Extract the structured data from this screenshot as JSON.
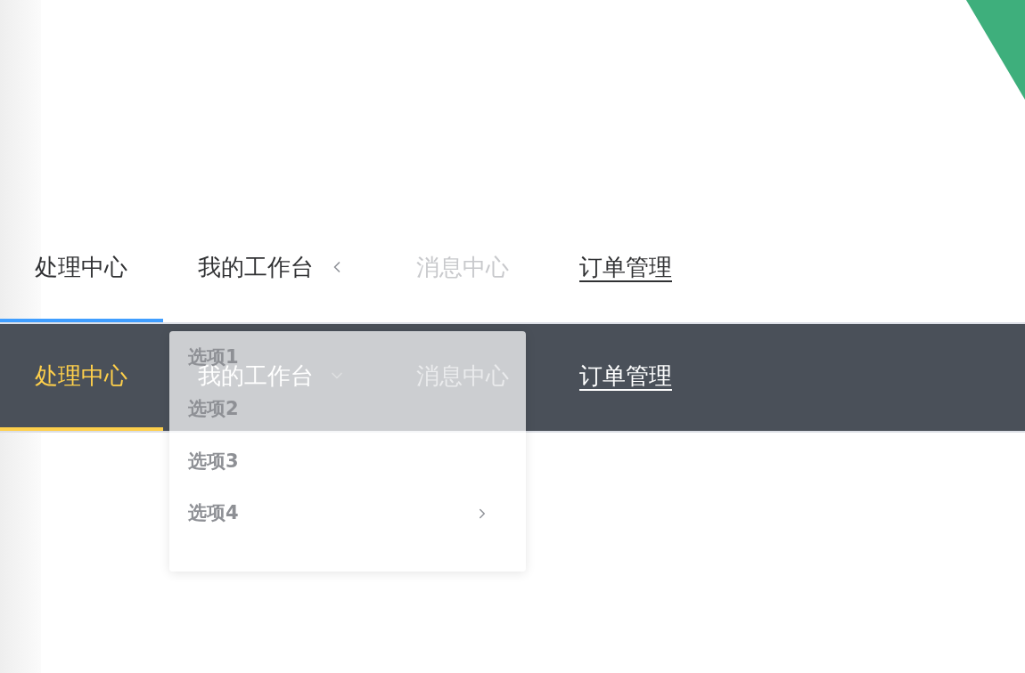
{
  "menus": [
    {
      "kind": "light",
      "items": [
        {
          "label": "处理中心",
          "kind": "item",
          "selected": true,
          "disabled": false
        },
        {
          "label": "我的工作台",
          "kind": "submenu",
          "selected": false,
          "disabled": false,
          "expanded": true
        },
        {
          "label": "消息中心",
          "kind": "item",
          "selected": false,
          "disabled": true
        },
        {
          "label": "订单管理",
          "kind": "link",
          "selected": false,
          "disabled": false
        }
      ]
    },
    {
      "kind": "dark",
      "items": [
        {
          "label": "处理中心",
          "kind": "item",
          "selected": true,
          "disabled": false
        },
        {
          "label": "我的工作台",
          "kind": "submenu",
          "selected": false,
          "disabled": false,
          "expanded": false
        },
        {
          "label": "消息中心",
          "kind": "item",
          "selected": false,
          "disabled": true
        },
        {
          "label": "订单管理",
          "kind": "link",
          "selected": false,
          "disabled": false
        }
      ]
    }
  ],
  "dropdown": {
    "items": [
      {
        "label": "选项1",
        "kind": "item"
      },
      {
        "label": "选项2",
        "kind": "item"
      },
      {
        "label": "选项3",
        "kind": "item"
      },
      {
        "label": "选项4",
        "kind": "submenu"
      }
    ]
  }
}
